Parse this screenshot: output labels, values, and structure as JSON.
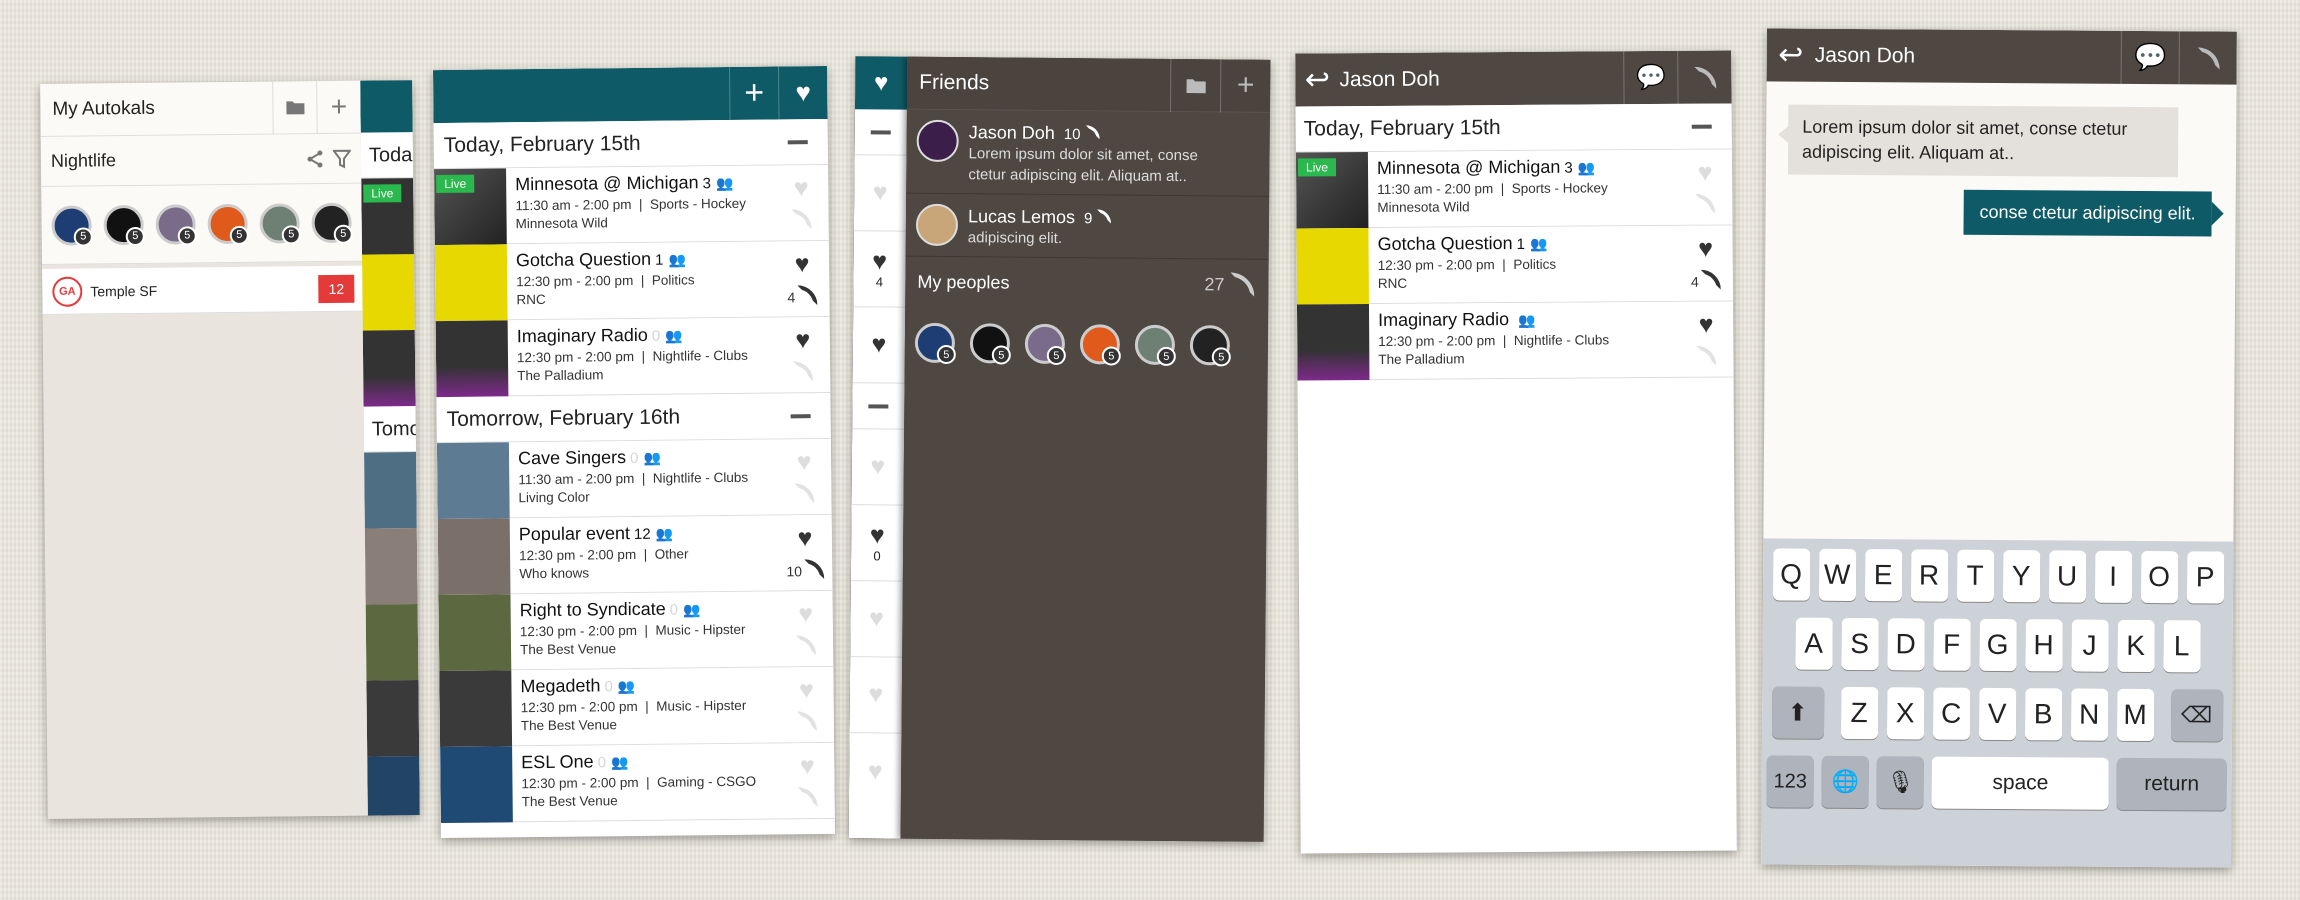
{
  "p1": {
    "title": "My Autokals",
    "filter_title": "Nightlife",
    "circles": [
      "5",
      "5",
      "5",
      "5",
      "5",
      "5"
    ],
    "list_item": {
      "name": "Temple SF",
      "count": "12",
      "logo_text": "GA"
    },
    "peek": {
      "day1": "Toda",
      "day2": "Tomo",
      "live": "Live"
    }
  },
  "p2": {
    "days": [
      {
        "title": "Today, February 15th",
        "events": [
          {
            "title": "Minnesota @ Michigan",
            "count": "3",
            "time": "11:30 am - 2:00 pm",
            "cat": "Sports - Hockey",
            "venue": "Minnesota Wild",
            "live": "Live",
            "liked": false,
            "feed": ""
          },
          {
            "title": "Gotcha Question",
            "count": "1",
            "time": "12:30 pm - 2:00 pm",
            "cat": "Politics",
            "venue": "RNC",
            "liked": true,
            "feed": "4"
          },
          {
            "title": "Imaginary Radio",
            "count": "0",
            "time": "12:30 pm - 2:00 pm",
            "cat": "Nightlife - Clubs",
            "venue": "The Palladium",
            "liked": true,
            "feed": ""
          }
        ]
      },
      {
        "title": "Tomorrow, February 16th",
        "events": [
          {
            "title": "Cave Singers",
            "count": "0",
            "time": "11:30 am - 2:00 pm",
            "cat": "Nightlife - Clubs",
            "venue": "Living Color",
            "liked": false,
            "feed": ""
          },
          {
            "title": "Popular event",
            "count": "12",
            "time": "12:30 pm - 2:00 pm",
            "cat": "Other",
            "venue": "Who knows",
            "liked": true,
            "feed": "10"
          },
          {
            "title": "Right to Syndicate",
            "count": "0",
            "time": "12:30 pm - 2:00 pm",
            "cat": "Music - Hipster",
            "venue": "The Best Venue",
            "liked": false,
            "feed": ""
          },
          {
            "title": "Megadeth",
            "count": "0",
            "time": "12:30 pm - 2:00 pm",
            "cat": "Music - Hipster",
            "venue": "The Best Venue",
            "liked": false,
            "feed": ""
          },
          {
            "title": "ESL One",
            "count": "0",
            "time": "12:30 pm - 2:00 pm",
            "cat": "Gaming - CSGO",
            "venue": "The Best Venue",
            "liked": false,
            "feed": ""
          }
        ]
      }
    ]
  },
  "p3": {
    "title": "Friends",
    "friends": [
      {
        "name": "Jason Doh",
        "count": "10",
        "msg1": "Lorem ipsum dolor sit amet, conse",
        "msg2": "ctetur adipiscing elit. Aliquam at.."
      },
      {
        "name": "Lucas Lemos",
        "count": "9",
        "msg1": "adipiscing elit.",
        "msg2": ""
      }
    ],
    "peoples_label": "My peoples",
    "peoples_count": "27",
    "circles": [
      "5",
      "5",
      "5",
      "5",
      "5",
      "5"
    ],
    "strip": {
      "f1": "4",
      "f2": "0"
    }
  },
  "p4": {
    "title": "Jason Doh",
    "day": "Today, February 15th",
    "events": [
      {
        "title": "Minnesota @ Michigan",
        "count": "3",
        "time": "11:30 am - 2:00 pm",
        "cat": "Sports - Hockey",
        "venue": "Minnesota Wild",
        "live": "Live",
        "liked": false,
        "feed": ""
      },
      {
        "title": "Gotcha Question",
        "count": "1",
        "time": "12:30 pm - 2:00 pm",
        "cat": "Politics",
        "venue": "RNC",
        "liked": true,
        "feed": "4"
      },
      {
        "title": "Imaginary Radio",
        "count": "",
        "time": "12:30 pm - 2:00 pm",
        "cat": "Nightlife - Clubs",
        "venue": "The Palladium",
        "liked": true,
        "feed": ""
      }
    ]
  },
  "p5": {
    "title": "Jason Doh",
    "msg_in": "Lorem ipsum dolor sit amet, conse ctetur adipiscing elit. Aliquam at..",
    "msg_out": "conse ctetur adipiscing elit.",
    "keys": {
      "row1": [
        "Q",
        "W",
        "E",
        "R",
        "T",
        "Y",
        "U",
        "I",
        "O",
        "P"
      ],
      "row2": [
        "A",
        "S",
        "D",
        "F",
        "G",
        "H",
        "J",
        "K",
        "L"
      ],
      "row3": [
        "Z",
        "X",
        "C",
        "V",
        "B",
        "N",
        "M"
      ],
      "num": "123",
      "space": "space",
      "ret": "return"
    }
  },
  "colors": {
    "teal": "#0e5b67",
    "dark": "#4e4742",
    "live": "#2bb84f",
    "badge_red": "#e53a3a"
  }
}
